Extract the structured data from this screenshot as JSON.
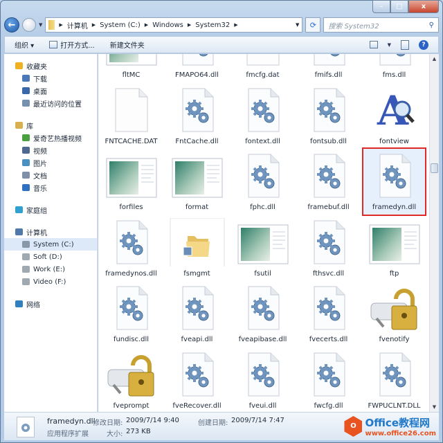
{
  "window": {
    "minimize": "–",
    "maximize": "□",
    "close": "x"
  },
  "nav": {
    "back": "←",
    "path": [
      "计算机",
      "System (C:)",
      "Windows",
      "System32"
    ],
    "search_placeholder": "搜索 System32"
  },
  "toolbar": {
    "organize": "组织 ▾",
    "open_with": "打开方式...",
    "new_folder": "新建文件夹"
  },
  "sidebar": [
    {
      "label": "收藏夹",
      "icon": "star-icon",
      "color": "#f0b020",
      "level": 0,
      "gap": false
    },
    {
      "label": "下载",
      "icon": "download-folder-icon",
      "color": "#4a78b8",
      "level": 1
    },
    {
      "label": "桌面",
      "icon": "desktop-icon",
      "color": "#3a68a8",
      "level": 1
    },
    {
      "label": "最近访问的位置",
      "icon": "recent-places-icon",
      "color": "#7890b0",
      "level": 1
    },
    {
      "label": "库",
      "icon": "library-icon",
      "color": "#d8b050",
      "level": 0,
      "gap": true
    },
    {
      "label": "爱奇艺热播视频",
      "icon": "video-library-icon",
      "color": "#4aa040",
      "level": 1
    },
    {
      "label": "视频",
      "icon": "video-icon",
      "color": "#506890",
      "level": 1
    },
    {
      "label": "图片",
      "icon": "pictures-icon",
      "color": "#4a90c0",
      "level": 1
    },
    {
      "label": "文档",
      "icon": "documents-icon",
      "color": "#8090a8",
      "level": 1
    },
    {
      "label": "音乐",
      "icon": "music-icon",
      "color": "#3070c0",
      "level": 1
    },
    {
      "label": "家庭组",
      "icon": "homegroup-icon",
      "color": "#30a0d0",
      "level": 0,
      "gap": true
    },
    {
      "label": "计算机",
      "icon": "computer-icon",
      "color": "#5078a8",
      "level": 0,
      "gap": true
    },
    {
      "label": "System (C:)",
      "icon": "drive-icon",
      "color": "#8898a8",
      "level": 1,
      "selected": true
    },
    {
      "label": "Soft (D:)",
      "icon": "drive-icon",
      "color": "#a0a8b0",
      "level": 1
    },
    {
      "label": "Work (E:)",
      "icon": "drive-icon",
      "color": "#a0a8b0",
      "level": 1
    },
    {
      "label": "Video (F:)",
      "icon": "drive-icon",
      "color": "#a0a8b0",
      "level": 1
    },
    {
      "label": "网络",
      "icon": "network-icon",
      "color": "#3080c0",
      "level": 0,
      "gap": true
    }
  ],
  "files": [
    {
      "name": "fltMC",
      "type": "app"
    },
    {
      "name": "FMAPO64.dll",
      "type": "dll"
    },
    {
      "name": "fmcfg.dat",
      "type": "blank"
    },
    {
      "name": "fmifs.dll",
      "type": "dll"
    },
    {
      "name": "fms.dll",
      "type": "dll"
    },
    {
      "name": "FNTCACHE.DAT",
      "type": "blank"
    },
    {
      "name": "FntCache.dll",
      "type": "dll"
    },
    {
      "name": "fontext.dll",
      "type": "dll"
    },
    {
      "name": "fontsub.dll",
      "type": "dll"
    },
    {
      "name": "fontview",
      "type": "font"
    },
    {
      "name": "forfiles",
      "type": "app"
    },
    {
      "name": "format",
      "type": "app"
    },
    {
      "name": "fphc.dll",
      "type": "dll"
    },
    {
      "name": "framebuf.dll",
      "type": "dll"
    },
    {
      "name": "framedyn.dll",
      "type": "dll",
      "selected": true
    },
    {
      "name": "framedynos.dll",
      "type": "dll"
    },
    {
      "name": "fsmgmt",
      "type": "folder"
    },
    {
      "name": "fsutil",
      "type": "app"
    },
    {
      "name": "fthsvc.dll",
      "type": "dll"
    },
    {
      "name": "ftp",
      "type": "app"
    },
    {
      "name": "fundisc.dll",
      "type": "dll"
    },
    {
      "name": "fveapi.dll",
      "type": "dll"
    },
    {
      "name": "fveapibase.dll",
      "type": "dll"
    },
    {
      "name": "fvecerts.dll",
      "type": "dll"
    },
    {
      "name": "fvenotify",
      "type": "lock"
    },
    {
      "name": "fveprompt",
      "type": "lock"
    },
    {
      "name": "fveRecover.dll",
      "type": "dll"
    },
    {
      "name": "fveui.dll",
      "type": "dll"
    },
    {
      "name": "fwcfg.dll",
      "type": "dll"
    },
    {
      "name": "FWPUCLNT.DLL",
      "type": "dll"
    }
  ],
  "status": {
    "name": "framedyn.dll",
    "type": "应用程序扩展",
    "modified_label": "修改日期:",
    "modified": "2009/7/14 9:40",
    "created_label": "创建日期:",
    "created": "2009/7/14 7:47",
    "size_label": "大小:",
    "size": "273 KB"
  },
  "watermark": {
    "brand": "Office教程网",
    "url": "www.office26.com"
  }
}
